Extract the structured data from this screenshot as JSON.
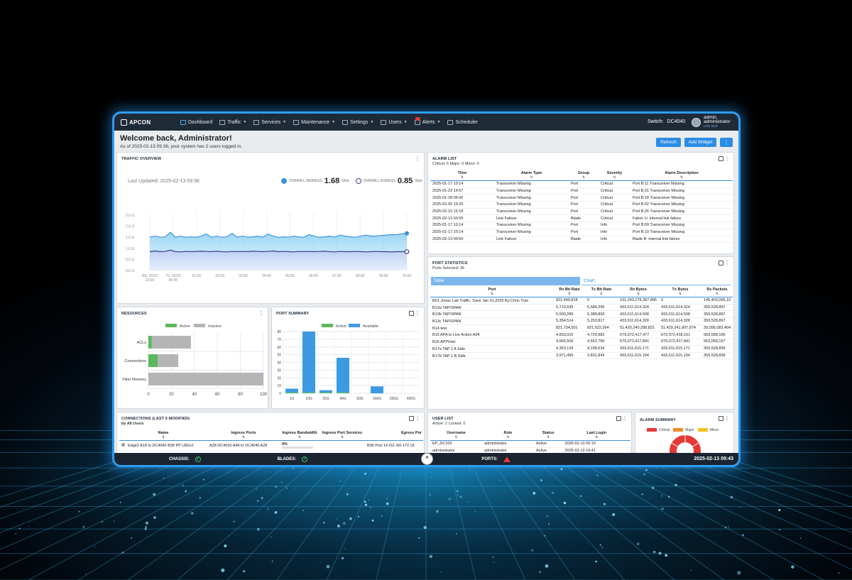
{
  "nav": {
    "logo": "APCON",
    "items": [
      {
        "label": "Dashboard",
        "caret": false
      },
      {
        "label": "Traffic",
        "caret": true
      },
      {
        "label": "Services",
        "caret": true
      },
      {
        "label": "Maintenance",
        "caret": true
      },
      {
        "label": "Settings",
        "caret": true
      },
      {
        "label": "Users",
        "caret": true
      },
      {
        "label": "Alerts",
        "caret": true
      },
      {
        "label": "Scheduler",
        "caret": false
      }
    ],
    "switch_label": "Switch:",
    "switch_value": "DC4040",
    "user_name": "admin,",
    "user_role": "administrator",
    "logout": "LOG OUT"
  },
  "header": {
    "welcome": "Welcome back, Administrator!",
    "subtext": "As of 2025-02-13 09:36, your system has 2 users logged in.",
    "refresh": "Refresh",
    "add_widget": "Add Widget",
    "more": "⋮"
  },
  "traffic": {
    "title": "TRAFFIC OVERVIEW",
    "last_updated": "Last Updated: 2025-02-13 09:36",
    "ingress_label": "OVERALL INGRESS",
    "ingress_value": "1.68",
    "egress_label": "OVERALL EGRESS",
    "egress_value": "0.85",
    "unit": "Gb/s",
    "y_ticks": [
      "2.5 G",
      "2.0 G",
      "1.5 G",
      "1.0 G",
      "0.5 G",
      "0.0 G"
    ],
    "x_ticks": [
      "We, 02/12",
      "Th, 02/13",
      "01:00",
      "02:00",
      "03:00",
      "04:00",
      "05:00",
      "06:00",
      "07:00",
      "08:00",
      "09:00",
      "10:00"
    ],
    "x_ticks_sub": [
      "23:00",
      "00:00"
    ],
    "ingress_series": [
      1.5,
      1.55,
      1.5,
      1.52,
      1.72,
      1.5,
      1.55,
      1.5,
      1.52,
      1.5,
      1.55,
      1.65,
      1.5,
      1.55,
      1.5,
      1.52,
      1.68,
      1.5,
      1.55,
      1.5,
      1.52,
      1.55,
      1.5,
      1.65,
      1.55,
      1.5,
      1.52,
      1.5,
      1.55,
      1.52,
      1.5,
      1.62,
      1.55,
      1.5,
      1.52,
      1.55,
      1.5,
      1.6,
      1.55,
      1.52,
      1.5,
      1.55,
      1.6,
      1.55,
      1.55,
      1.58,
      1.6,
      1.62,
      1.62,
      1.65,
      1.68
    ],
    "egress_series": [
      0.85,
      0.88,
      0.85,
      0.86,
      0.92,
      0.85,
      0.84,
      0.86,
      0.85,
      0.86,
      0.87,
      0.86,
      0.85,
      0.87,
      0.85,
      0.84,
      0.86,
      0.85,
      0.86,
      0.85,
      0.87,
      0.86,
      0.85,
      0.86,
      0.88,
      0.85,
      0.86,
      0.85,
      0.84,
      0.86,
      0.85,
      0.86,
      0.85,
      0.86,
      0.87,
      0.85,
      0.84,
      0.86,
      0.85,
      0.85,
      0.86,
      0.85,
      0.84,
      0.85,
      0.86,
      0.85,
      0.85,
      0.84,
      0.85,
      0.85,
      0.85
    ],
    "colors": {
      "ingress": "#3a94dc",
      "egress": "#3b3f8a"
    }
  },
  "alarms": {
    "title": "ALARM LIST",
    "subtitle": "Critical: 6 Major: 0 Minor: 0",
    "columns": [
      "Time",
      "Alarm Type",
      "Group",
      "Severity",
      "Alarm Description"
    ],
    "rows": [
      [
        "2025-01-17 10:14",
        "Transceiver Missing",
        "Port",
        "Critical",
        "Port B:11 Transceiver Missing"
      ],
      [
        "2025-01-23 14:57",
        "Transceiver Missing",
        "Port",
        "Critical",
        "Port B:31 Transceiver Missing"
      ],
      [
        "2025-01-28 06:42",
        "Transceiver Missing",
        "Port",
        "Critical",
        "Port B:18 Transceiver Missing"
      ],
      [
        "2025-02-05 15:20",
        "Transceiver Missing",
        "Port",
        "Critical",
        "Port B:32 Transceiver Missing"
      ],
      [
        "2025-02-10 15:18",
        "Transceiver Missing",
        "Port",
        "Critical",
        "Port B:26 Transceiver Missing"
      ],
      [
        "2025-02-13 03:55",
        "Link Failure",
        "Blade",
        "Critical",
        "Fabric U: internal link failure"
      ],
      [
        "2025-01-17 10:14",
        "Transceiver Missing",
        "Port",
        "Info",
        "Port B:09 Transceiver Missing"
      ],
      [
        "2025-01-17 10:14",
        "Transceiver Missing",
        "Port",
        "Info",
        "Port B:10 Transceiver Missing"
      ],
      [
        "2025-02-13 00:50",
        "Link Failure",
        "Blade",
        "Info",
        "Blade B: internal link failure"
      ]
    ]
  },
  "port_stats": {
    "title": "PORT STATISTICS",
    "subtitle": "Ports Selected: 36",
    "tab_table": "Table",
    "tab_chart": "Chart",
    "columns": [
      "Port",
      "Rx Bit Rate",
      "Tx Bit Rate",
      "Rx Bytes",
      "Tx Bytes",
      "Rx Packets"
    ],
    "rows": [
      [
        "B01 Jonas Lab Traffic: Save Jan 01,2025 By:Chris Tran",
        "822,449,818",
        "0",
        "191,243,278,387,895",
        "0",
        "145,403,056,10"
      ],
      [
        "B13a TAP/SPAN",
        "5,710,535",
        "5,584,396",
        "433,611,614,324",
        "433,611,614,324",
        "359,528,897"
      ],
      [
        "B13b TAP/SPAN",
        "5,500,289",
        "5,388,803",
        "433,611,614,508",
        "433,611,614,508",
        "359,528,897"
      ],
      [
        "B13c TAP/SPAN",
        "5,354,514",
        "5,253,817",
        "433,611,614,328",
        "433,611,614,328",
        "359,528,897"
      ],
      [
        "B14 test",
        "821,734,501",
        "821,622,264",
        "51,420,240,298,821",
        "51,420,241,907,874",
        "39,095,083,404"
      ],
      [
        "B15 APA to Live Action A04",
        "4,833,010",
        "4,729,982",
        "679,072,417,477",
        "679,072,418,161",
        "563,058,166"
      ],
      [
        "B16 APPIntel",
        "4,666,506",
        "4,552,760",
        "679,072,417,841",
        "679,072,417,841",
        "563,058,167"
      ],
      [
        "B17a TAP 1 A Side",
        "4,353,134",
        "4,238,634",
        "433,611,615,171",
        "433,611,615,171",
        "359,528,899"
      ],
      [
        "B17b TAP 1 B Side",
        "3,971,490",
        "3,831,843",
        "433,611,615,194",
        "433,611,615,194",
        "359,528,899"
      ]
    ]
  },
  "resources": {
    "title": "RESOURCES",
    "legend_active": "Active",
    "legend_inactive": "Inactive",
    "x_ticks": [
      "0",
      "20",
      "40",
      "60",
      "80",
      "100"
    ],
    "colors": {
      "active": "#5cb85c",
      "inactive": "#b5b5b5"
    }
  },
  "port_summary": {
    "title": "PORT SUMMARY",
    "legend_active": "Active",
    "legend_available": "Available",
    "y_ticks": [
      "0",
      "10",
      "20",
      "30",
      "40",
      "50",
      "60",
      "70",
      "80"
    ],
    "colors": {
      "active": "#5cb85c",
      "available": "#3b9ae1"
    }
  },
  "connections": {
    "title": "CONNECTIONS (LAST 5 MODIFIED)",
    "subtitle": "by All Users",
    "columns": [
      "Name",
      "Ingress Ports",
      "Ingress Bandwidth",
      "Ingress Port Services",
      "Egress Por"
    ],
    "row": {
      "name": "Edge2 A18 to DC4040 B36 PP LBGv1",
      "ingress_ports": "A28 DC4010 A48 to DC4040 A28",
      "bandwidth": "0%",
      "services": "",
      "egress": "B36 Port 14 IS2 XR-172.16"
    }
  },
  "users": {
    "title": "USER LIST",
    "subtitle": "Active: 2 Locked: 0",
    "columns": [
      "Username",
      "Role",
      "Status",
      "Last Login"
    ],
    "rows": [
      [
        "EP_DC100",
        "administrator",
        "Active",
        "2025-02-13 00:10"
      ],
      [
        "administrator",
        "administrator",
        "Active",
        "2025-02-13 16:41"
      ]
    ]
  },
  "alarm_summary": {
    "title": "ALARM SUMMARY",
    "legend": [
      "Critical",
      "Major",
      "Minor"
    ],
    "colors": {
      "critical": "#e53935",
      "major": "#f28c28",
      "minor": "#f2c21b"
    }
  },
  "status": {
    "chassis": "CHASSIS:",
    "blades": "BLADES:",
    "ports": "PORTS:",
    "datetime": "2025-02-13 09:43",
    "collapse": "^"
  },
  "chart_data": [
    {
      "type": "bar",
      "title": "RESOURCES",
      "orientation": "horizontal",
      "stacked": true,
      "categories": [
        "ACLs",
        "Connections",
        "Filter Memory"
      ],
      "series": [
        {
          "name": "Active",
          "values": [
            3,
            8,
            0
          ]
        },
        {
          "name": "Inactive",
          "values": [
            34,
            18,
            100
          ]
        }
      ],
      "xlim": [
        0,
        100
      ]
    },
    {
      "type": "bar",
      "title": "PORT SUMMARY",
      "stacked": true,
      "categories": [
        "1G",
        "10G",
        "25G",
        "40G",
        "50G",
        "100G",
        "200G",
        "400G"
      ],
      "series": [
        {
          "name": "Active",
          "values": [
            1,
            1,
            1,
            1,
            0,
            0,
            0,
            0
          ]
        },
        {
          "name": "Available",
          "values": [
            5,
            79,
            3,
            45,
            0,
            9,
            0,
            0
          ]
        }
      ],
      "ylim": [
        0,
        80
      ]
    },
    {
      "type": "pie",
      "title": "ALARM SUMMARY",
      "categories": [
        "Critical",
        "Major",
        "Minor"
      ],
      "values": [
        6,
        0,
        0
      ]
    }
  ]
}
